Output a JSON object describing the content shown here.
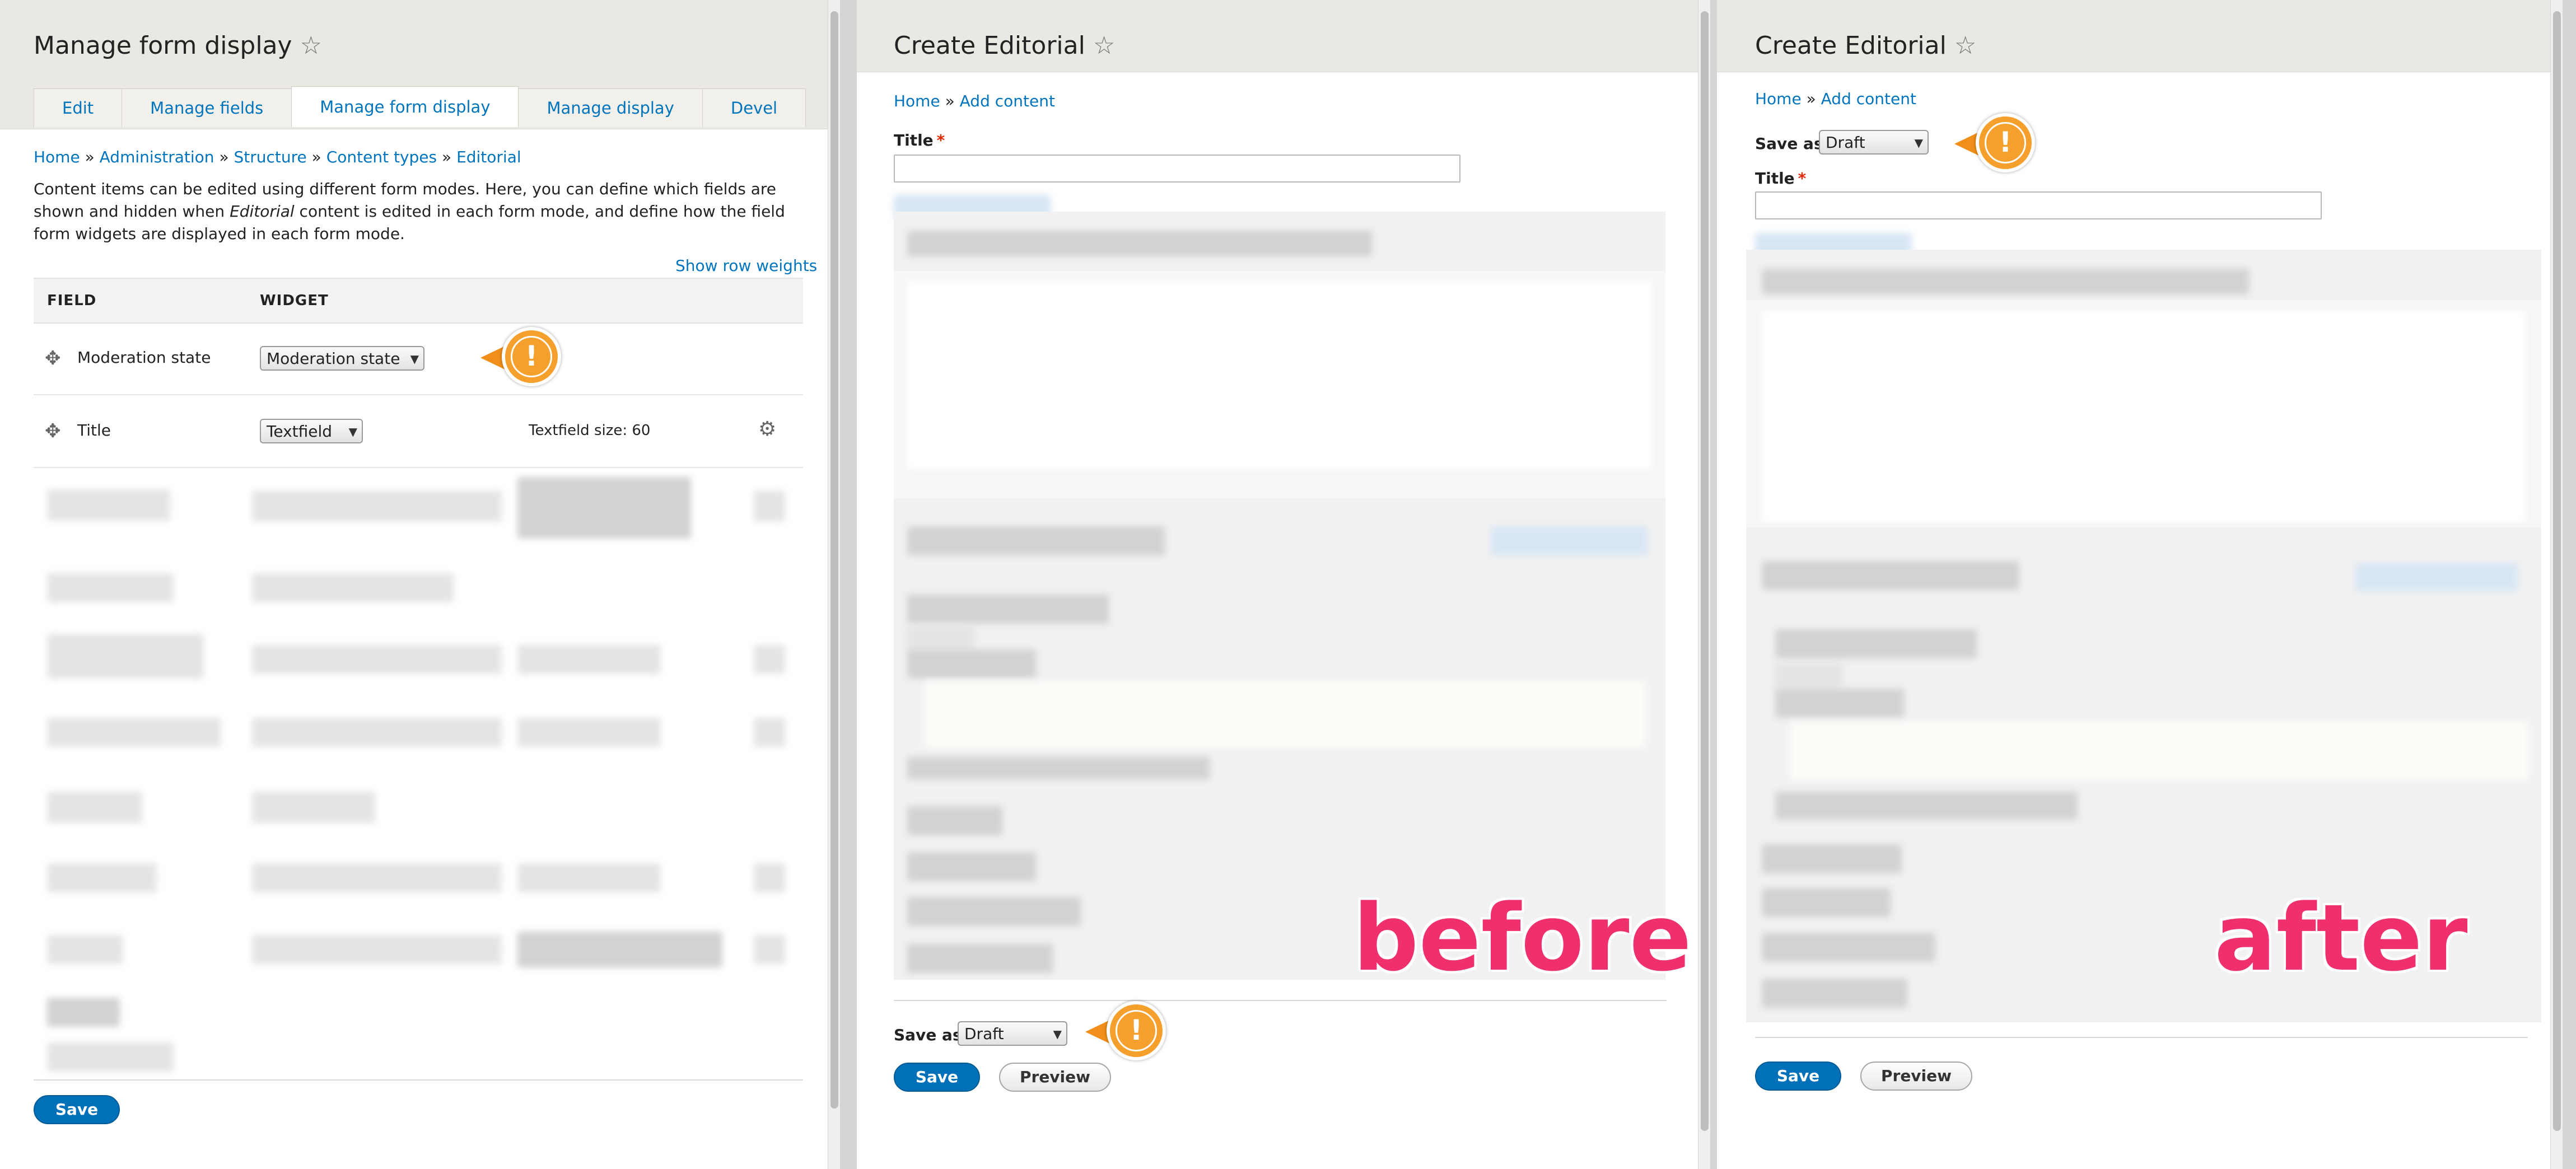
{
  "left": {
    "title": "Manage form display",
    "tabs": [
      {
        "label": "Edit"
      },
      {
        "label": "Manage fields"
      },
      {
        "label": "Manage form display"
      },
      {
        "label": "Manage display"
      },
      {
        "label": "Devel"
      }
    ],
    "breadcrumb": [
      "Home",
      "Administration",
      "Structure",
      "Content types",
      "Editorial"
    ],
    "breadcrumb_sep": "»",
    "description_part1": "Content items can be edited using different form modes. Here, you can define which fields are shown and hidden when ",
    "description_em": "Editorial",
    "description_part2": " content is edited in each form mode, and define how the field form widgets are displayed in each form mode.",
    "show_row_weights": "Show row weights",
    "col_field": "FIELD",
    "col_widget": "WIDGET",
    "rows": [
      {
        "field": "Moderation state",
        "widget": "Moderation state",
        "summary": ""
      },
      {
        "field": "Title",
        "widget": "Textfield",
        "summary": "Textfield size: 60"
      }
    ],
    "save_label": "Save"
  },
  "middle": {
    "title": "Create Editorial",
    "breadcrumb": [
      "Home",
      "Add content"
    ],
    "breadcrumb_sep": "»",
    "title_label": "Title",
    "required_mark": "*",
    "save_as_label": "Save as:",
    "save_as_value": "Draft",
    "save_label": "Save",
    "preview_label": "Preview",
    "caption": "before"
  },
  "right": {
    "title": "Create Editorial",
    "breadcrumb": [
      "Home",
      "Add content"
    ],
    "breadcrumb_sep": "»",
    "save_as_label": "Save as:",
    "save_as_value": "Draft",
    "title_label": "Title",
    "required_mark": "*",
    "save_label": "Save",
    "preview_label": "Preview",
    "caption": "after"
  },
  "icons": {
    "star": "☆",
    "drag": "✥",
    "gear": "⚙",
    "alert": "!",
    "dropdown": "▼"
  },
  "colors": {
    "link": "#0074bd",
    "primary_button": "#0071b8",
    "alert_orange": "#f5a02c",
    "caption_pink": "#f0306d",
    "header_bg": "#e9e8e2",
    "required": "#e32700"
  }
}
